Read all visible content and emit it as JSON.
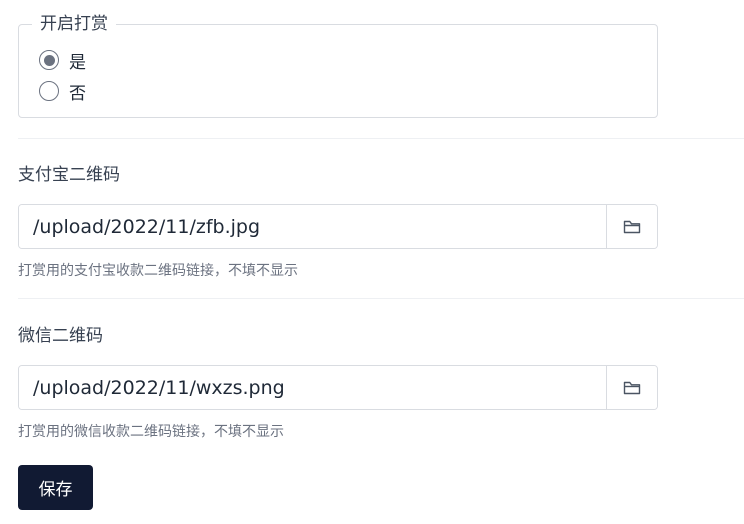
{
  "reward": {
    "legend": "开启打赏",
    "options": [
      {
        "label": "是",
        "selected": true
      },
      {
        "label": "否",
        "selected": false
      }
    ]
  },
  "alipay": {
    "label": "支付宝二维码",
    "value": "/upload/2022/11/zfb.jpg",
    "help": "打赏用的支付宝收款二维码链接，不填不显示",
    "browse_icon": "folder-icon"
  },
  "wechat": {
    "label": "微信二维码",
    "value": "/upload/2022/11/wxzs.png",
    "help": "打赏用的微信收款二维码链接，不填不显示",
    "browse_icon": "folder-icon"
  },
  "actions": {
    "save_label": "保存"
  },
  "colors": {
    "primary": "#111a33",
    "border": "#d9dce1",
    "radio": "#6b7280"
  }
}
